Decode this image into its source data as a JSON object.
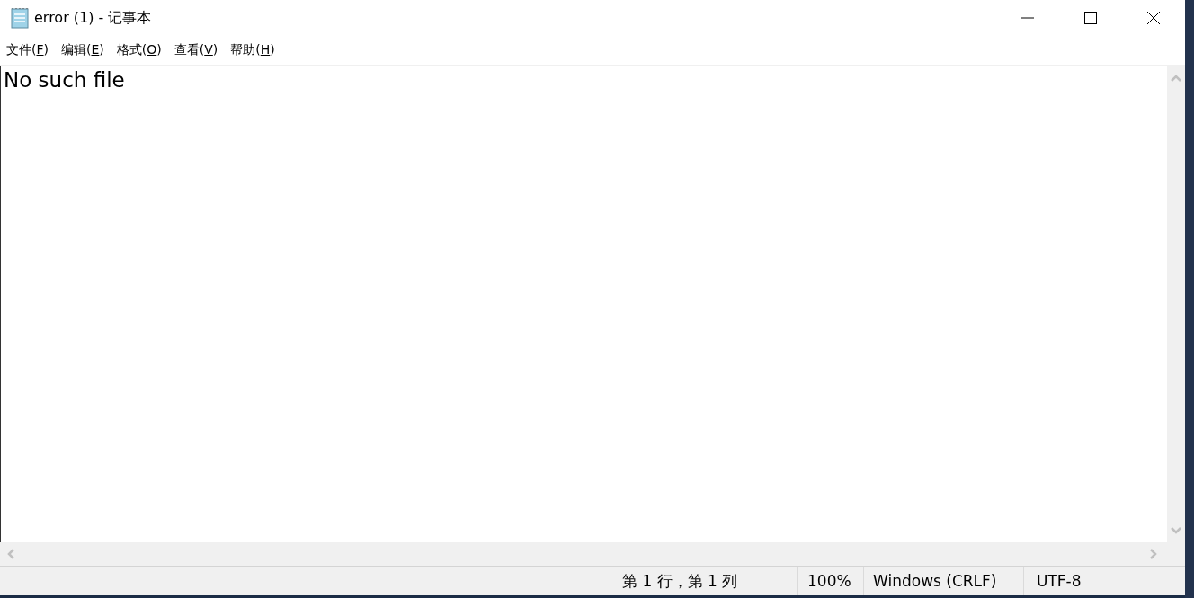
{
  "window": {
    "title": "error (1) - 记事本"
  },
  "menu": [
    {
      "before": "文件(",
      "key": "F",
      "after": ")"
    },
    {
      "before": "编辑(",
      "key": "E",
      "after": ")"
    },
    {
      "before": "格式(",
      "key": "O",
      "after": ")"
    },
    {
      "before": "查看(",
      "key": "V",
      "after": ")"
    },
    {
      "before": "帮助(",
      "key": "H",
      "after": ")"
    }
  ],
  "editor": {
    "text": "No such file"
  },
  "status_bar": [
    "第 1 行，第 1 列",
    "100%",
    "Windows (CRLF)",
    "UTF-8"
  ]
}
